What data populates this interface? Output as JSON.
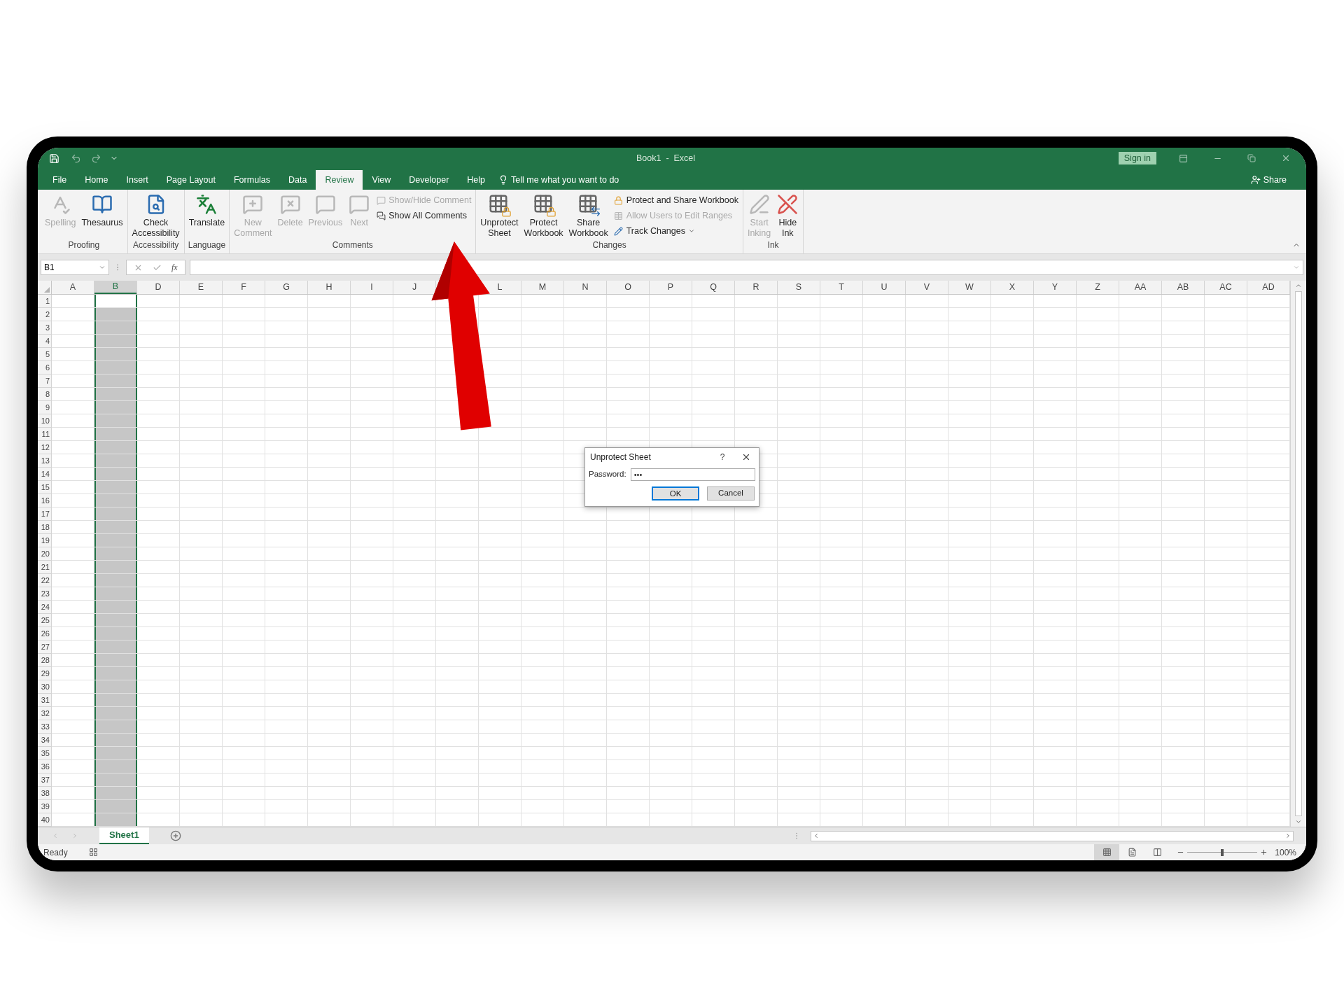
{
  "title_bar": {
    "title": "Book1  -  Excel",
    "sign_in": "Sign in"
  },
  "tabs": [
    {
      "label": "File",
      "selected": false
    },
    {
      "label": "Home",
      "selected": false
    },
    {
      "label": "Insert",
      "selected": false
    },
    {
      "label": "Page Layout",
      "selected": false
    },
    {
      "label": "Formulas",
      "selected": false
    },
    {
      "label": "Data",
      "selected": false
    },
    {
      "label": "Review",
      "selected": true
    },
    {
      "label": "View",
      "selected": false
    },
    {
      "label": "Developer",
      "selected": false
    },
    {
      "label": "Help",
      "selected": false
    }
  ],
  "tell_me": "Tell me what you want to do",
  "share": "Share",
  "ribbon": {
    "groups": [
      {
        "label": "Proofing",
        "items": [
          {
            "kind": "large",
            "label": "Spelling",
            "disabled": true
          },
          {
            "kind": "large",
            "label": "Thesaurus",
            "disabled": false
          }
        ]
      },
      {
        "label": "Accessibility",
        "items": [
          {
            "kind": "large",
            "label": "Check Accessibility",
            "disabled": false
          }
        ]
      },
      {
        "label": "Language",
        "items": [
          {
            "kind": "large",
            "label": "Translate",
            "disabled": false
          }
        ]
      },
      {
        "label": "Comments",
        "items": [
          {
            "kind": "large",
            "label": "New Comment",
            "disabled": true
          },
          {
            "kind": "large",
            "label": "Delete",
            "disabled": true
          },
          {
            "kind": "large",
            "label": "Previous",
            "disabled": true
          },
          {
            "kind": "large",
            "label": "Next",
            "disabled": true
          },
          {
            "kind": "small",
            "label": "Show/Hide Comment",
            "disabled": true
          },
          {
            "kind": "small",
            "label": "Show All Comments",
            "disabled": false
          }
        ]
      },
      {
        "label": "Changes",
        "items": [
          {
            "kind": "large",
            "label": "Unprotect Sheet",
            "disabled": false
          },
          {
            "kind": "large",
            "label": "Protect Workbook",
            "disabled": false
          },
          {
            "kind": "large",
            "label": "Share Workbook",
            "disabled": false
          },
          {
            "kind": "small",
            "label": "Protect and Share Workbook",
            "disabled": false
          },
          {
            "kind": "small",
            "label": "Allow Users to Edit Ranges",
            "disabled": true
          },
          {
            "kind": "small",
            "label": "Track Changes",
            "disabled": false,
            "dropdown": true
          }
        ]
      },
      {
        "label": "Ink",
        "items": [
          {
            "kind": "large",
            "label": "Start Inking",
            "disabled": true
          },
          {
            "kind": "large",
            "label": "Hide Ink",
            "disabled": false
          }
        ]
      }
    ]
  },
  "formula_bar": {
    "name_box": "B1",
    "function_label": "fx"
  },
  "sheet": {
    "columns": [
      {
        "label": "A",
        "selected": false
      },
      {
        "label": "B",
        "selected": true
      },
      {
        "label": "D",
        "selected": false
      },
      {
        "label": "E",
        "selected": false
      },
      {
        "label": "F",
        "selected": false
      },
      {
        "label": "G",
        "selected": false
      },
      {
        "label": "H",
        "selected": false
      },
      {
        "label": "I",
        "selected": false
      },
      {
        "label": "J",
        "selected": false
      },
      {},
      {
        "label": "L",
        "selected": false
      },
      {
        "label": "M",
        "selected": false
      },
      {
        "label": "N",
        "selected": false
      },
      {
        "label": "O",
        "selected": false
      },
      {
        "label": "P",
        "selected": false
      },
      {
        "label": "Q",
        "selected": false
      },
      {
        "label": "R",
        "selected": false
      },
      {
        "label": "S",
        "selected": false
      },
      {
        "label": "T",
        "selected": false
      },
      {
        "label": "U",
        "selected": false
      },
      {
        "label": "V",
        "selected": false
      },
      {
        "label": "W",
        "selected": false
      },
      {
        "label": "X",
        "selected": false
      },
      {
        "label": "Y",
        "selected": false
      },
      {
        "label": "Z",
        "selected": false
      },
      {
        "label": "AA",
        "selected": false
      },
      {
        "label": "AB",
        "selected": false
      },
      {
        "label": "AC",
        "selected": false
      },
      {
        "label": "AD",
        "selected": false
      }
    ],
    "rows": [
      {
        "label": "1",
        "active": true
      },
      {
        "label": "2",
        "active": false
      },
      {
        "label": "3",
        "active": false
      },
      {
        "label": "4",
        "active": false
      },
      {
        "label": "5",
        "active": false
      },
      {
        "label": "6",
        "active": false
      },
      {
        "label": "7",
        "active": false
      },
      {
        "label": "8",
        "active": false
      },
      {
        "label": "9",
        "active": false
      },
      {
        "label": "10",
        "active": false
      },
      {
        "label": "11",
        "active": false
      },
      {
        "label": "12",
        "active": false
      },
      {
        "label": "13",
        "active": false
      },
      {
        "label": "14",
        "active": false
      },
      {
        "label": "15",
        "active": false
      },
      {
        "label": "16",
        "active": false
      },
      {
        "label": "17",
        "active": false
      },
      {
        "label": "18",
        "active": false
      },
      {
        "label": "19",
        "active": false
      },
      {
        "label": "20",
        "active": false
      },
      {
        "label": "21",
        "active": false
      },
      {
        "label": "22",
        "active": false
      },
      {
        "label": "23",
        "active": false
      },
      {
        "label": "24",
        "active": false
      },
      {
        "label": "25",
        "active": false
      },
      {
        "label": "26",
        "active": false
      },
      {
        "label": "27",
        "active": false
      },
      {
        "label": "28",
        "active": false
      },
      {
        "label": "29",
        "active": false
      },
      {
        "label": "30",
        "active": false
      },
      {
        "label": "31",
        "active": false
      },
      {
        "label": "32",
        "active": false
      },
      {
        "label": "33",
        "active": false
      },
      {
        "label": "34",
        "active": false
      },
      {
        "label": "35",
        "active": false
      },
      {
        "label": "36",
        "active": false
      },
      {
        "label": "37",
        "active": false
      },
      {
        "label": "38",
        "active": false
      },
      {
        "label": "39",
        "active": false
      },
      {
        "label": "40",
        "active": false
      }
    ]
  },
  "dialog": {
    "title": "Unprotect Sheet",
    "help": "?",
    "password_label": "Password:",
    "password_value": "•••",
    "buttons": [
      {
        "label": "OK",
        "default": true
      },
      {
        "label": "Cancel",
        "default": false
      }
    ]
  },
  "sheet_tabs": [
    {
      "label": "Sheet1",
      "selected": true
    }
  ],
  "status_bar": {
    "status": "Ready",
    "views": [
      {
        "selected": true
      },
      {
        "selected": false
      },
      {
        "selected": false
      }
    ],
    "zoom": {
      "level": 0.5,
      "reading": "100%"
    }
  }
}
